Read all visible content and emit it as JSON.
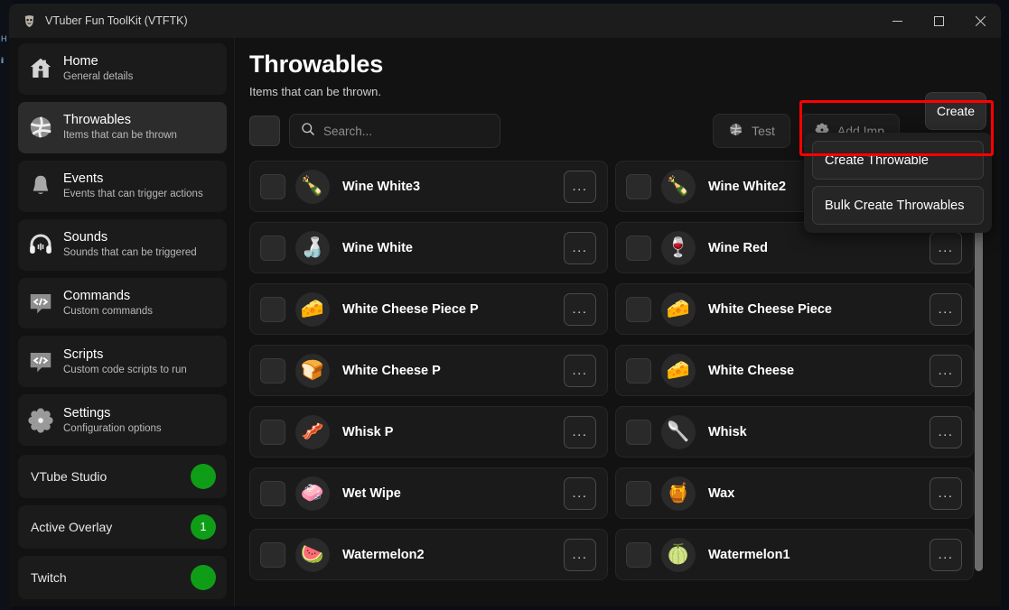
{
  "window": {
    "title": "VTuber Fun ToolKit (VTFTK)",
    "app_icon": "vtftk-logo-icon",
    "controls": {
      "minimize": "minimize-icon",
      "maximize": "maximize-icon",
      "close": "close-icon"
    }
  },
  "background_sliver": {
    "line1": "H",
    "line2": "il"
  },
  "sidebar": {
    "items": [
      {
        "title": "Home",
        "sub": "General details",
        "icon": "home-icon",
        "active": false
      },
      {
        "title": "Throwables",
        "sub": "Items that can be thrown",
        "icon": "throwable-ball-icon",
        "active": true
      },
      {
        "title": "Events",
        "sub": "Events that can trigger actions",
        "icon": "bell-icon",
        "active": false
      },
      {
        "title": "Sounds",
        "sub": "Sounds that can be triggered",
        "icon": "headphones-icon",
        "active": false
      },
      {
        "title": "Commands",
        "sub": "Custom commands",
        "icon": "code-bubble-icon",
        "active": false
      },
      {
        "title": "Scripts",
        "sub": "Custom code scripts to run",
        "icon": "code-bubble-icon",
        "active": false
      },
      {
        "title": "Settings",
        "sub": "Configuration options",
        "icon": "gear-icon",
        "active": false
      }
    ],
    "statuses": [
      {
        "label": "VTube Studio",
        "badge": "",
        "color": "#0f9d18"
      },
      {
        "label": "Active Overlay",
        "badge": "1",
        "color": "#0f9d18"
      },
      {
        "label": "Twitch",
        "badge": "",
        "color": "#0f9d18"
      }
    ]
  },
  "main": {
    "title": "Throwables",
    "subtitle": "Items that can be thrown.",
    "create_label": "Create",
    "toolbar": {
      "select_all_checkbox": "select-all-checkbox",
      "search_placeholder": "Search...",
      "search_value": "",
      "test_label": "Test",
      "add_image_label": "Add Imp"
    },
    "dropdown": {
      "items": [
        "Create Throwable",
        "Bulk Create Throwables"
      ],
      "highlighted_index": 0,
      "highlight_color": "#ff0000"
    },
    "columns": [
      [
        {
          "name": "Wine White3",
          "emoji": "🍾",
          "menu": "..."
        },
        {
          "name": "Wine White",
          "emoji": "🍶",
          "menu": "..."
        },
        {
          "name": "White Cheese Piece P",
          "emoji": "🧀",
          "menu": "..."
        },
        {
          "name": "White Cheese P",
          "emoji": "🍞",
          "menu": "..."
        },
        {
          "name": "Whisk P",
          "emoji": "🥓",
          "menu": "..."
        },
        {
          "name": "Wet Wipe",
          "emoji": "🧼",
          "menu": "..."
        },
        {
          "name": "Watermelon2",
          "emoji": "🍉",
          "menu": "..."
        }
      ],
      [
        {
          "name": "Wine White2",
          "emoji": "🍾",
          "menu": "..."
        },
        {
          "name": "Wine Red",
          "emoji": "🍷",
          "menu": "..."
        },
        {
          "name": "White Cheese Piece",
          "emoji": "🧀",
          "menu": "..."
        },
        {
          "name": "White Cheese",
          "emoji": "🧀",
          "menu": "..."
        },
        {
          "name": "Whisk",
          "emoji": "🥄",
          "menu": "..."
        },
        {
          "name": "Wax",
          "emoji": "🍯",
          "menu": "..."
        },
        {
          "name": "Watermelon1",
          "emoji": "🍈",
          "menu": "..."
        }
      ]
    ]
  }
}
